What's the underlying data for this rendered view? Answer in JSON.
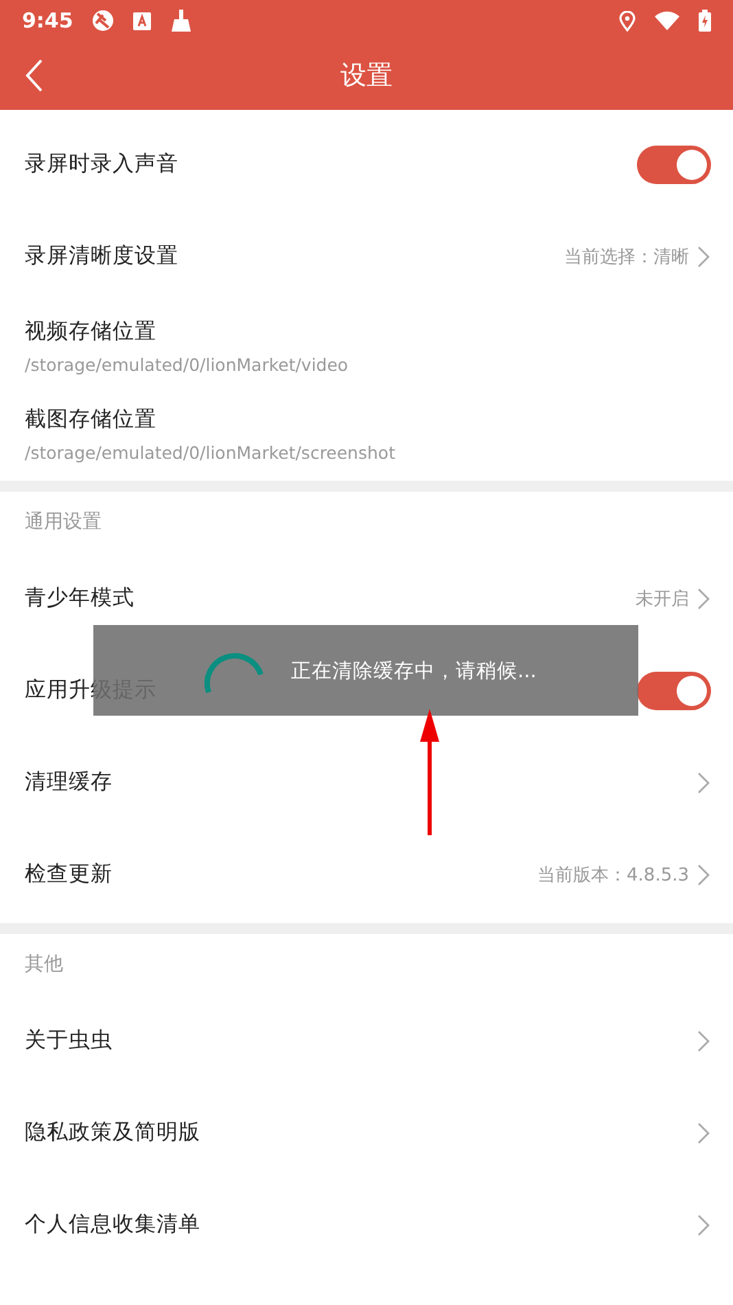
{
  "status_bar": {
    "time": "9:45"
  },
  "header": {
    "title": "设置"
  },
  "sections": [
    {
      "items": [
        {
          "kind": "toggle",
          "label": "录屏时录入声音",
          "on": true
        },
        {
          "kind": "link",
          "label": "录屏清晰度设置",
          "value": "当前选择：清晰"
        },
        {
          "kind": "path",
          "label": "视频存储位置",
          "subtitle": "/storage/emulated/0/lionMarket/video"
        },
        {
          "kind": "path",
          "label": "截图存储位置",
          "subtitle": "/storage/emulated/0/lionMarket/screenshot"
        }
      ]
    },
    {
      "title": "通用设置",
      "items": [
        {
          "kind": "link",
          "label": "青少年模式",
          "value": "未开启"
        },
        {
          "kind": "toggle",
          "label": "应用升级提示",
          "on": true
        },
        {
          "kind": "link",
          "label": "清理缓存"
        },
        {
          "kind": "link",
          "label": "检查更新",
          "value": "当前版本：4.8.5.3"
        }
      ]
    },
    {
      "title": "其他",
      "items": [
        {
          "kind": "link",
          "label": "关于虫虫"
        },
        {
          "kind": "link",
          "label": "隐私政策及简明版"
        },
        {
          "kind": "link",
          "label": "个人信息收集清单"
        }
      ]
    }
  ],
  "toast": {
    "message": "正在清除缓存中，请稍候..."
  }
}
